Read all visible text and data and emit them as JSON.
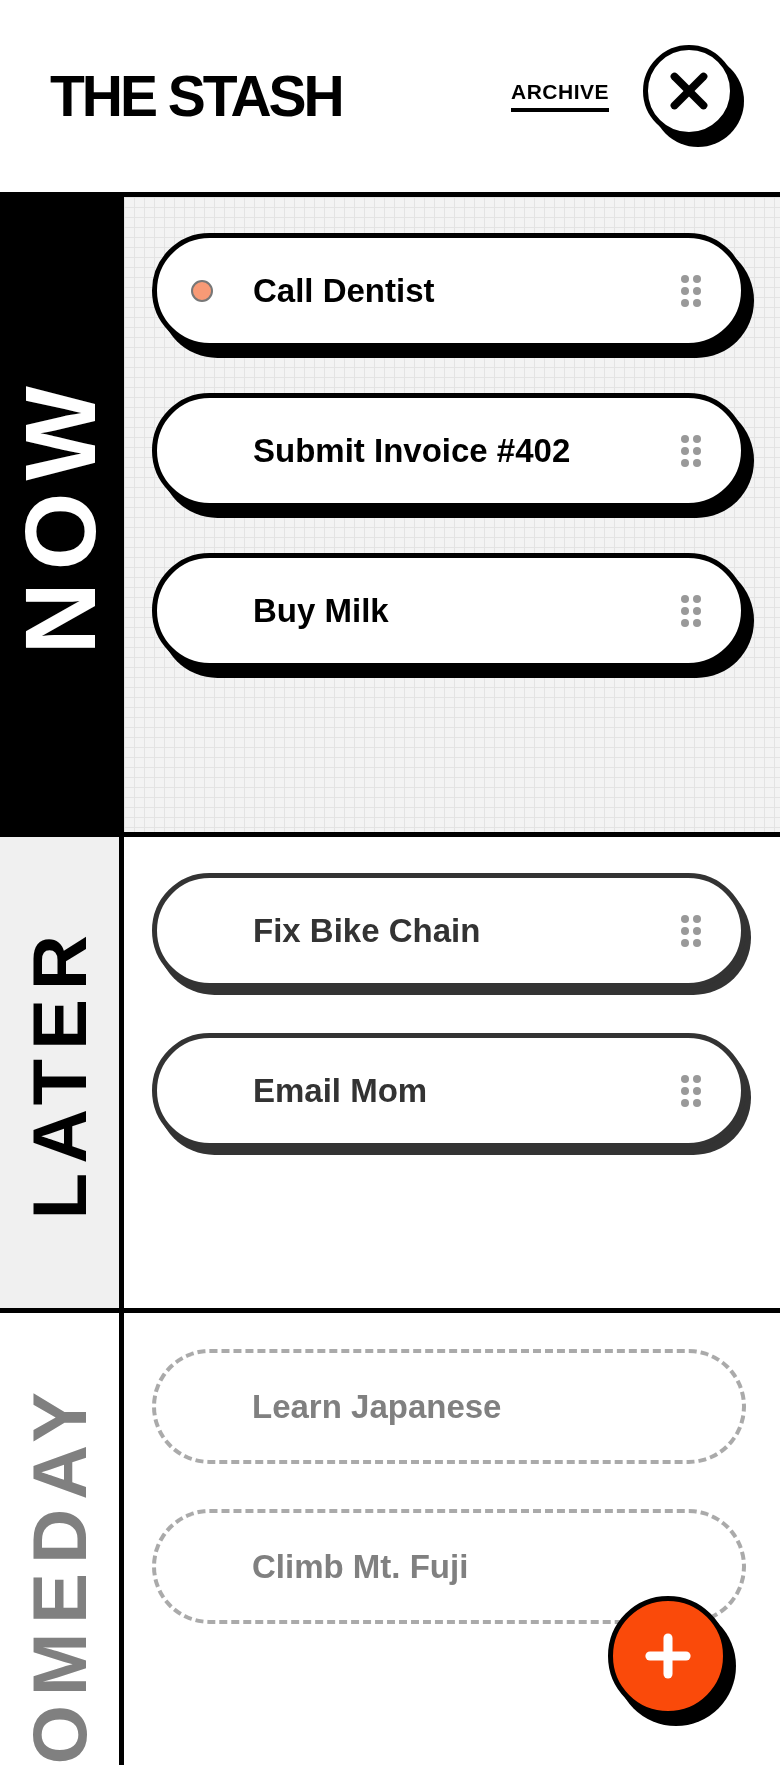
{
  "header": {
    "title": "THE STASH",
    "archive_link": "ARCHIVE"
  },
  "sections": [
    {
      "kind": "now",
      "label": "NOW",
      "items": [
        {
          "title": "Call Dentist",
          "marked": true
        },
        {
          "title": "Submit Invoice #402",
          "marked": false
        },
        {
          "title": "Buy Milk",
          "marked": false
        }
      ]
    },
    {
      "kind": "later",
      "label": "LATER",
      "items": [
        {
          "title": "Fix Bike Chain",
          "marked": false
        },
        {
          "title": "Email Mom",
          "marked": false
        }
      ]
    },
    {
      "kind": "someday",
      "label": "OMEDAY",
      "items": [
        {
          "title": "Learn Japanese",
          "marked": false
        },
        {
          "title": "Climb Mt. Fuji",
          "marked": false
        }
      ]
    }
  ]
}
